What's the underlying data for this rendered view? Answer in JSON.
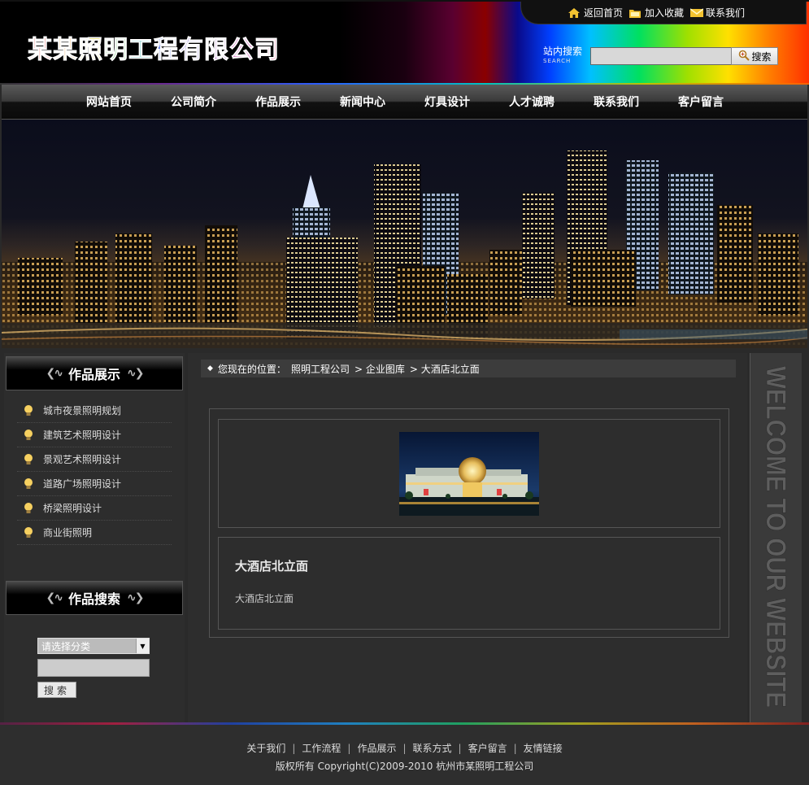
{
  "header": {
    "logo_chars": [
      {
        "char": "某",
        "color": "#e0201a"
      },
      {
        "char": "某",
        "color": "#e08a1a"
      },
      {
        "char": "照",
        "color": "#d8c81a"
      },
      {
        "char": "明",
        "color": "#1aa020"
      },
      {
        "char": "工",
        "color": "#1aa0a0"
      },
      {
        "char": "程",
        "color": "#1a40d0"
      },
      {
        "char": "有",
        "color": "#4020c0"
      },
      {
        "char": "限",
        "color": "#8a20b0"
      },
      {
        "char": "公",
        "color": "#c020a0"
      },
      {
        "char": "司",
        "color": "#d02060"
      }
    ],
    "top_links": [
      {
        "label": "返回首页",
        "icon": "home-icon"
      },
      {
        "label": "加入收藏",
        "icon": "folder-icon"
      },
      {
        "label": "联系我们",
        "icon": "mail-icon"
      }
    ],
    "search": {
      "label": "站内搜索",
      "label_en": "SEARCH",
      "value": "",
      "button": "搜索"
    }
  },
  "nav": [
    "网站首页",
    "公司简介",
    "作品展示",
    "新闻中心",
    "灯具设计",
    "人才诚聘",
    "联系我们",
    "客户留言"
  ],
  "sidebar": {
    "title": "作品展示",
    "categories": [
      "城市夜景照明规划",
      "建筑艺术照明设计",
      "景观艺术照明设计",
      "道路广场照明设计",
      "桥梁照明设计",
      "商业街照明"
    ],
    "search_title": "作品搜索",
    "select_value": "请选择分类",
    "keyword": "",
    "search_button": "搜索"
  },
  "breadcrumb": {
    "prefix": "您现在的位置：",
    "items": [
      "照明工程公司",
      "> 企业图库",
      "> 大酒店北立面"
    ]
  },
  "content": {
    "title": "大酒店北立面",
    "text": "大酒店北立面"
  },
  "welcome_text": "WELCOME TO OUR WEBSITE",
  "footer": {
    "links": [
      "关于我们",
      "工作流程",
      "作品展示",
      "联系方式",
      "客户留言",
      "友情链接"
    ],
    "copyright": "版权所有  Copyright(C)2009-2010 杭州市某照明工程公司"
  }
}
